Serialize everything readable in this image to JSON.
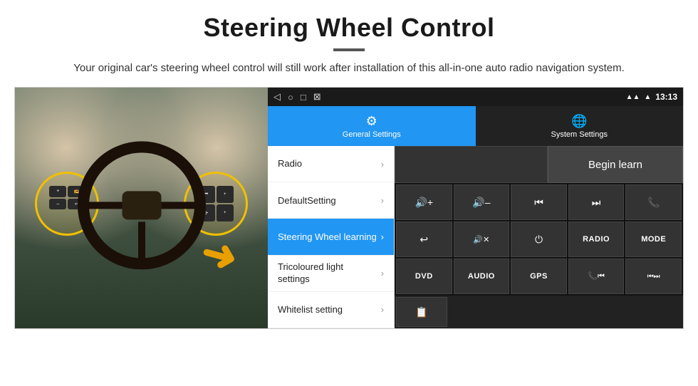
{
  "header": {
    "title": "Steering Wheel Control",
    "divider": true,
    "subtitle": "Your original car's steering wheel control will still work after installation of this all-in-one auto radio navigation system."
  },
  "statusbar": {
    "nav_back": "◁",
    "nav_home": "○",
    "nav_recent": "□",
    "nav_extra": "⊠",
    "time": "13:13",
    "signal1": "▲",
    "signal2": "▲"
  },
  "tabs": {
    "general": {
      "label": "General Settings",
      "icon": "⚙"
    },
    "system": {
      "label": "System Settings",
      "icon": "🌐"
    }
  },
  "menu": {
    "items": [
      {
        "label": "Radio",
        "active": false
      },
      {
        "label": "DefaultSetting",
        "active": false
      },
      {
        "label": "Steering Wheel learning",
        "active": true
      },
      {
        "label": "Tricoloured light settings",
        "active": false
      },
      {
        "label": "Whitelist setting",
        "active": false
      }
    ]
  },
  "controls": {
    "begin_learn_label": "Begin learn",
    "buttons": [
      {
        "label": "🔊+",
        "type": "icon"
      },
      {
        "label": "🔊–",
        "type": "icon"
      },
      {
        "label": "⏮",
        "type": "icon"
      },
      {
        "label": "⏭",
        "type": "icon"
      },
      {
        "label": "📞",
        "type": "icon"
      },
      {
        "label": "↩",
        "type": "icon"
      },
      {
        "label": "🔊✕",
        "type": "icon"
      },
      {
        "label": "⏻",
        "type": "icon"
      },
      {
        "label": "RADIO",
        "type": "text"
      },
      {
        "label": "MODE",
        "type": "text"
      },
      {
        "label": "DVD",
        "type": "text"
      },
      {
        "label": "AUDIO",
        "type": "text"
      },
      {
        "label": "GPS",
        "type": "text"
      },
      {
        "label": "📞⏮",
        "type": "icon"
      },
      {
        "label": "⏮⏭",
        "type": "icon"
      },
      {
        "label": "📋",
        "type": "icon"
      }
    ]
  }
}
